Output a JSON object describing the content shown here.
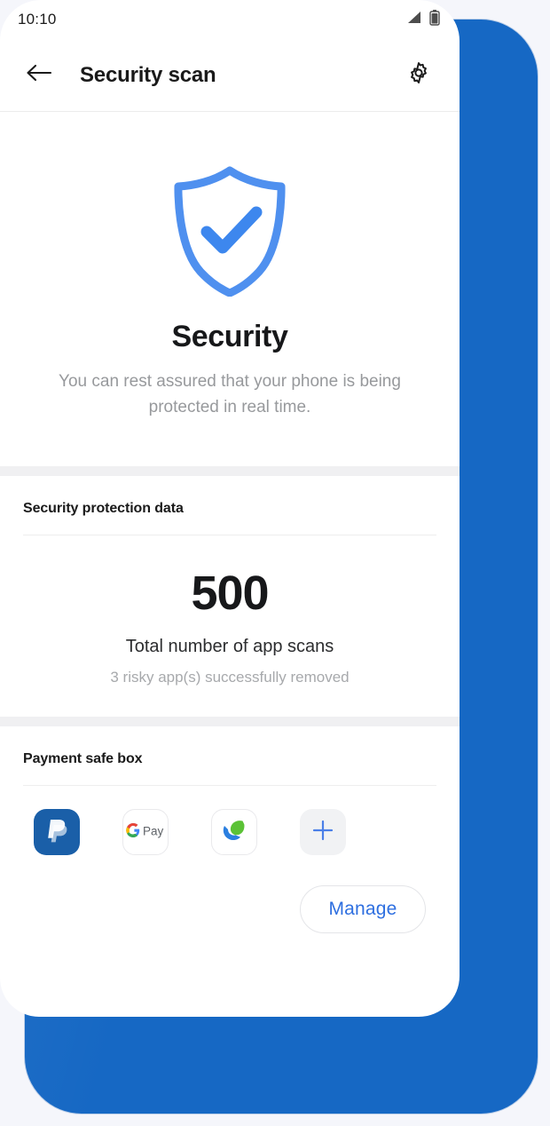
{
  "theme": {
    "accent_blue": "#2e6fe0",
    "backdrop_blue": "#1668c4",
    "shield_blue": "#4f90ef",
    "page_bg": "#f5f6fb",
    "muted_text": "#97999c"
  },
  "status_bar": {
    "time": "10:10",
    "signal_icon": "signal-bars-icon",
    "battery_icon": "battery-icon"
  },
  "app_bar": {
    "back_icon": "back-arrow-icon",
    "title": "Security scan",
    "settings_icon": "gear-icon"
  },
  "hero": {
    "icon": "shield-check-icon",
    "title": "Security",
    "subtitle": "You can rest assured that your phone is being protected in real time."
  },
  "protection_section": {
    "heading": "Security protection data",
    "stat_number": "500",
    "stat_label": "Total number of app scans",
    "stat_note": "3 risky app(s) successfully removed"
  },
  "payment_section": {
    "heading": "Payment safe box",
    "apps": [
      {
        "name": "PayPal",
        "icon": "paypal-icon"
      },
      {
        "name": "Google Pay",
        "icon": "google-pay-icon",
        "mark": "G",
        "wordmark": "Pay"
      },
      {
        "name": "Wallet app",
        "icon": "leaf-wallet-icon"
      },
      {
        "name": "Add app",
        "icon": "plus-icon"
      }
    ],
    "manage_label": "Manage"
  }
}
